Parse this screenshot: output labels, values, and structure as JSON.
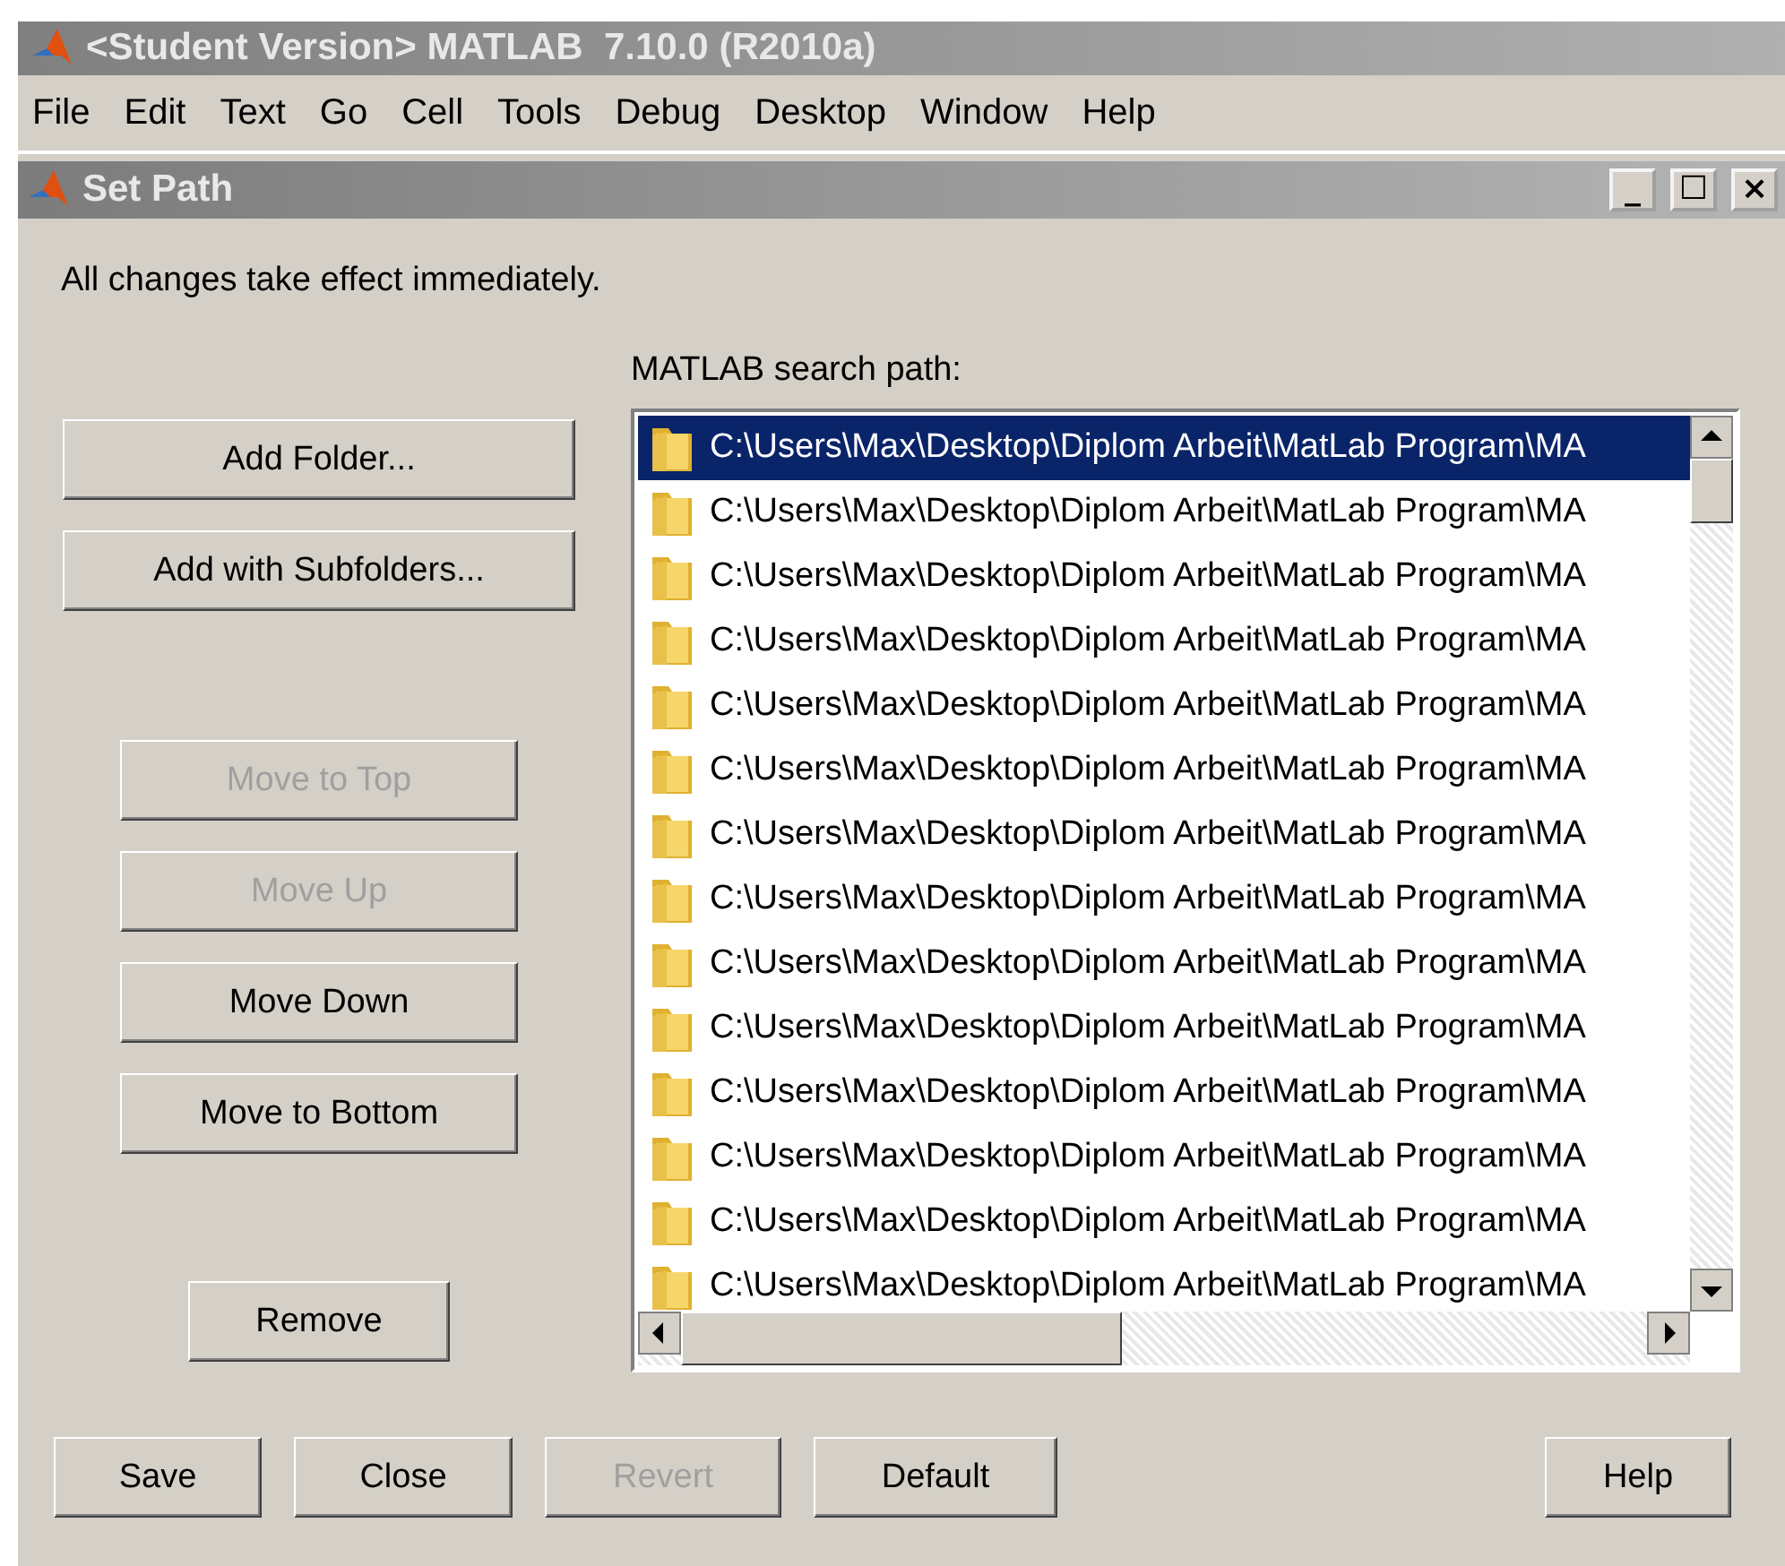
{
  "window": {
    "title": "<Student Version> MATLAB  7.10.0 (R2010a)"
  },
  "menu": [
    "File",
    "Edit",
    "Text",
    "Go",
    "Cell",
    "Tools",
    "Debug",
    "Desktop",
    "Window",
    "Help"
  ],
  "dialog": {
    "title": "Set Path",
    "controls": [
      "_",
      "☐",
      "×"
    ]
  },
  "info": "All changes take effect immediately.",
  "path_label": "MATLAB search path:",
  "top_buttons": [
    {
      "label": "Add Folder...",
      "disabled": false
    },
    {
      "label": "Add with Subfolders...",
      "disabled": false
    }
  ],
  "move_buttons": [
    {
      "label": "Move to Top",
      "disabled": true
    },
    {
      "label": "Move Up",
      "disabled": true
    },
    {
      "label": "Move Down",
      "disabled": false
    },
    {
      "label": "Move to Bottom",
      "disabled": false
    }
  ],
  "remove_button": {
    "label": "Remove",
    "disabled": false
  },
  "paths": [
    {
      "text": "C:\\Users\\Max\\Desktop\\Diplom Arbeit\\MatLab Program\\MA",
      "selected": true
    },
    {
      "text": "C:\\Users\\Max\\Desktop\\Diplom Arbeit\\MatLab Program\\MA",
      "selected": false
    },
    {
      "text": "C:\\Users\\Max\\Desktop\\Diplom Arbeit\\MatLab Program\\MA",
      "selected": false
    },
    {
      "text": "C:\\Users\\Max\\Desktop\\Diplom Arbeit\\MatLab Program\\MA",
      "selected": false
    },
    {
      "text": "C:\\Users\\Max\\Desktop\\Diplom Arbeit\\MatLab Program\\MA",
      "selected": false
    },
    {
      "text": "C:\\Users\\Max\\Desktop\\Diplom Arbeit\\MatLab Program\\MA",
      "selected": false
    },
    {
      "text": "C:\\Users\\Max\\Desktop\\Diplom Arbeit\\MatLab Program\\MA",
      "selected": false
    },
    {
      "text": "C:\\Users\\Max\\Desktop\\Diplom Arbeit\\MatLab Program\\MA",
      "selected": false
    },
    {
      "text": "C:\\Users\\Max\\Desktop\\Diplom Arbeit\\MatLab Program\\MA",
      "selected": false
    },
    {
      "text": "C:\\Users\\Max\\Desktop\\Diplom Arbeit\\MatLab Program\\MA",
      "selected": false
    },
    {
      "text": "C:\\Users\\Max\\Desktop\\Diplom Arbeit\\MatLab Program\\MA",
      "selected": false
    },
    {
      "text": "C:\\Users\\Max\\Desktop\\Diplom Arbeit\\MatLab Program\\MA",
      "selected": false
    },
    {
      "text": "C:\\Users\\Max\\Desktop\\Diplom Arbeit\\MatLab Program\\MA",
      "selected": false
    },
    {
      "text": "C:\\Users\\Max\\Desktop\\Diplom Arbeit\\MatLab Program\\MA",
      "selected": false
    }
  ],
  "bottom_buttons": [
    {
      "label": "Save",
      "disabled": false
    },
    {
      "label": "Close",
      "disabled": false
    },
    {
      "label": "Revert",
      "disabled": true
    },
    {
      "label": "Default",
      "disabled": false
    }
  ],
  "help_button": {
    "label": "Help",
    "disabled": false
  }
}
